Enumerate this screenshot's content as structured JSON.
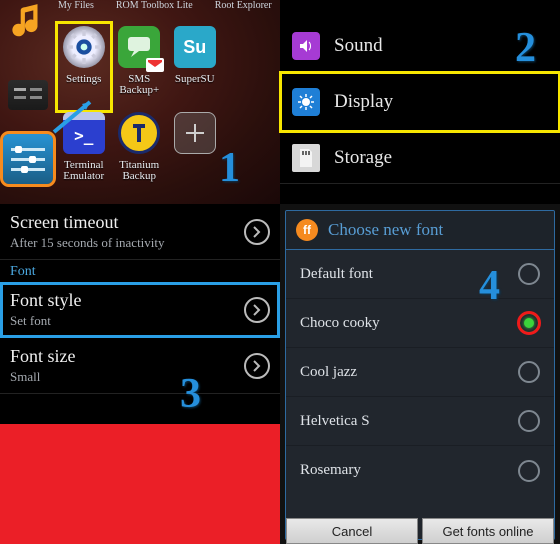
{
  "p1": {
    "top_labels": [
      "My Files",
      "ROM Toolbox Lite",
      "Root Explorer"
    ],
    "apps": [
      {
        "label": "Settings",
        "icon": "gear"
      },
      {
        "label": "SMS Backup+",
        "icon": "sms"
      },
      {
        "label": "SuperSU",
        "icon": "su"
      },
      {
        "label": "Terminal Emulator",
        "icon": "terminal"
      },
      {
        "label": "Titanium Backup",
        "icon": "titanium"
      },
      {
        "label": "",
        "icon": "plus"
      }
    ],
    "num": "1"
  },
  "p2": {
    "items": [
      {
        "label": "Sound",
        "icon": "sound"
      },
      {
        "label": "Display",
        "icon": "display"
      },
      {
        "label": "Storage",
        "icon": "storage"
      }
    ],
    "num": "2"
  },
  "p3": {
    "rows": [
      {
        "title": "Screen timeout",
        "sub": "After 15 seconds of inactivity"
      },
      {
        "cat": "Font"
      },
      {
        "title": "Font style",
        "sub": "Set font"
      },
      {
        "title": "Font size",
        "sub": "Small"
      }
    ],
    "num": "3"
  },
  "p4": {
    "title": "Choose new font",
    "fonts": [
      "Default font",
      "Choco cooky",
      "Cool jazz",
      "Helvetica S",
      "Rosemary"
    ],
    "selected": 1,
    "buttons": {
      "cancel": "Cancel",
      "online": "Get fonts online"
    },
    "num": "4"
  }
}
